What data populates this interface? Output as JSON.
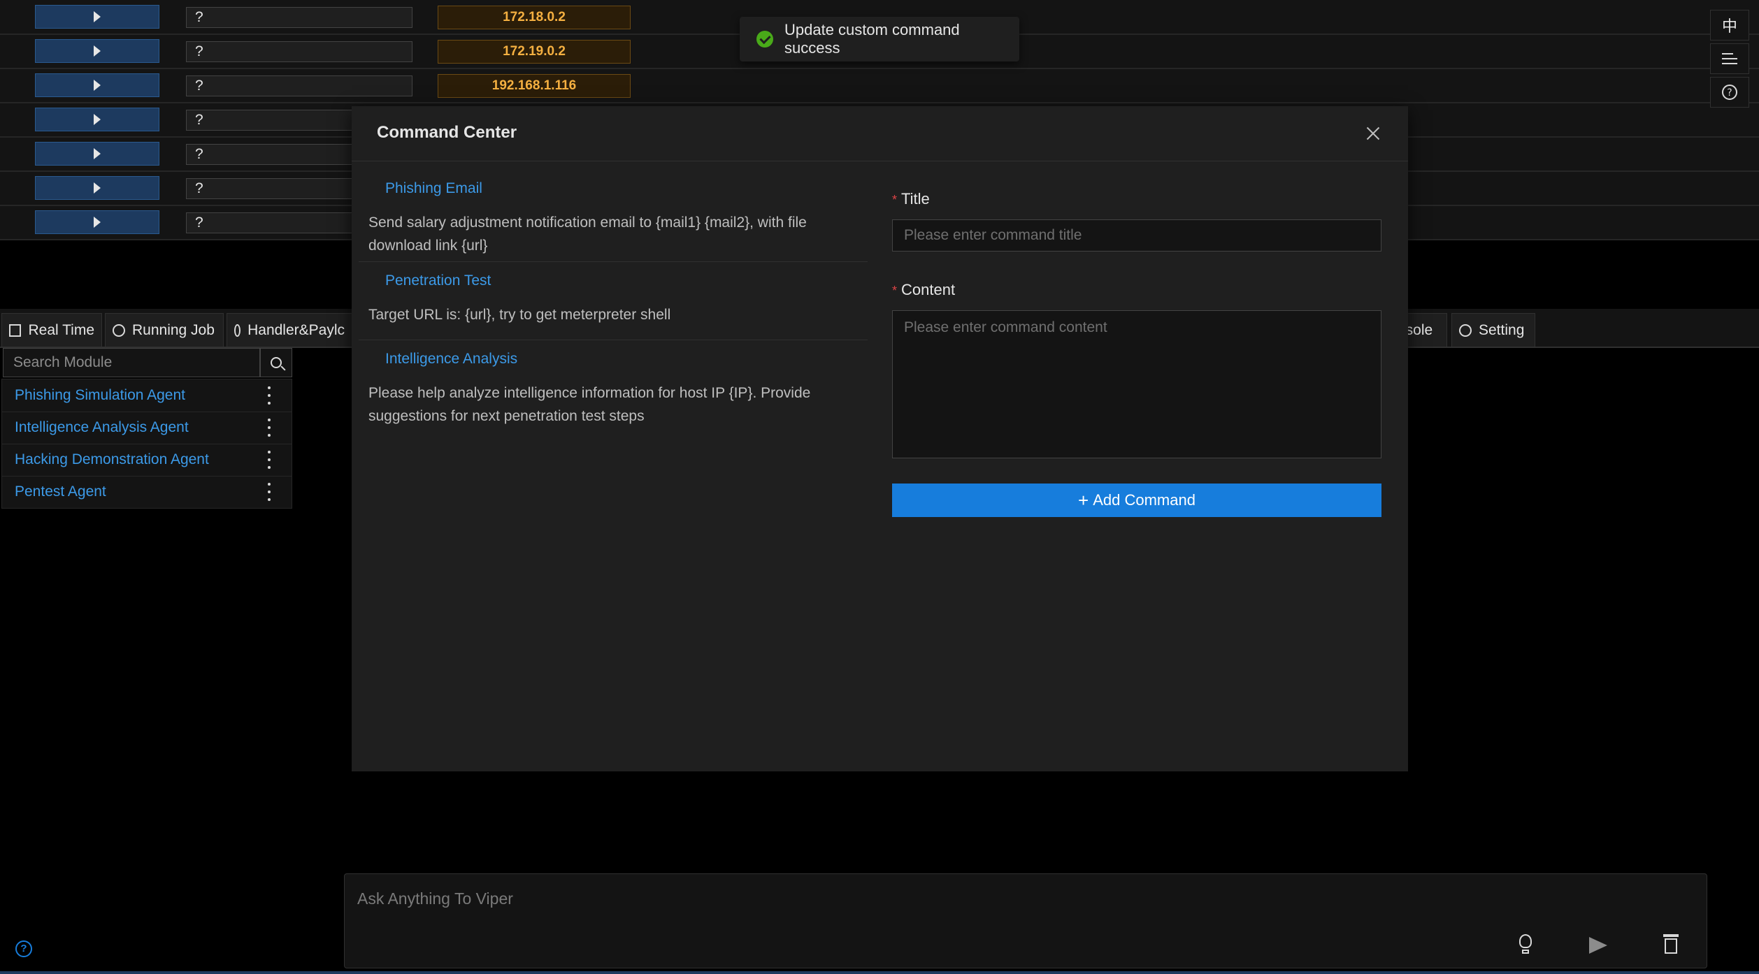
{
  "hosts": [
    {
      "action": "",
      "status": "?",
      "ip": "172.18.0.2"
    },
    {
      "action": "",
      "status": "?",
      "ip": "172.19.0.2"
    },
    {
      "action": "",
      "status": "?",
      "ip": "192.168.1.116"
    },
    {
      "action": "",
      "status": "?",
      "ip": ""
    },
    {
      "action": "",
      "status": "?",
      "ip": ""
    },
    {
      "action": "",
      "status": "?",
      "ip": ""
    },
    {
      "action": "",
      "status": "?",
      "ip": ""
    }
  ],
  "right_toolbar": {
    "lang": "中",
    "menu_icon": "menu-icon",
    "help_icon": "question-circle-icon"
  },
  "toast": {
    "message": "Update custom command success",
    "icon": "check-circle-icon"
  },
  "tabs": {
    "real_time": "Real Time",
    "running_job": "Running Job",
    "handler": "Handler&Paylc",
    "console": "nsole",
    "setting": "Setting"
  },
  "modules": {
    "search_placeholder": "Search Module",
    "items": [
      {
        "label": "Phishing Simulation Agent"
      },
      {
        "label": "Intelligence Analysis Agent"
      },
      {
        "label": "Hacking Demonstration Agent"
      },
      {
        "label": "Pentest Agent"
      }
    ]
  },
  "modal": {
    "title": "Command Center",
    "commands": [
      {
        "title": "Phishing Email",
        "content": "Send salary adjustment notification email to {mail1} {mail2}, with file download link {url}"
      },
      {
        "title": "Penetration Test",
        "content": "Target URL is: {url}, try to get meterpreter shell"
      },
      {
        "title": "Intelligence Analysis",
        "content": "Please help analyze intelligence information for host IP {IP}. Provide suggestions for next penetration test steps"
      }
    ],
    "form": {
      "title_label": "Title",
      "title_placeholder": "Please enter command title",
      "content_label": "Content",
      "content_placeholder": "Please enter command content",
      "required_mark": "*",
      "add_label": "Add Command",
      "add_plus": "+"
    }
  },
  "chat": {
    "placeholder": "Ask Anything To Viper"
  },
  "colors": {
    "accent": "#177ddc",
    "link": "#3c9ae8",
    "ip": "#f5b041",
    "success": "#49aa19",
    "required": "#dc4446"
  }
}
